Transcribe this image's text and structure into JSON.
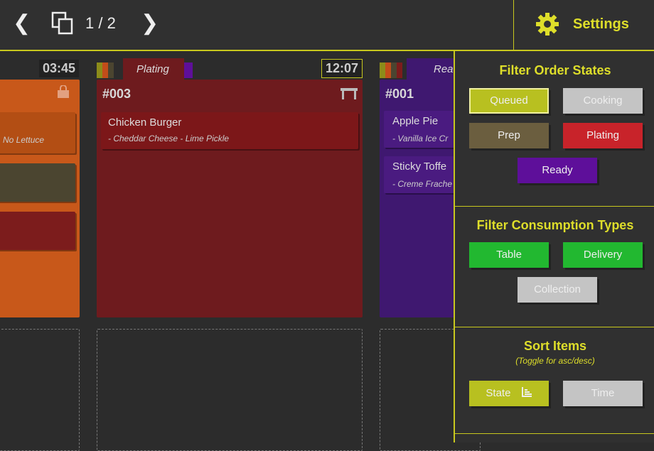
{
  "topbar": {
    "prev_icon": "chevron-left-icon",
    "next_icon": "chevron-right-icon",
    "pages_icon": "pages-icon",
    "page_label": "1 / 2",
    "settings_icon": "gear-icon",
    "settings_label": "Settings"
  },
  "orders": [
    {
      "number": "",
      "timer": "03:45",
      "state": "",
      "consumption_icon": "bag-icon",
      "color": "#c8581a",
      "items": [
        {
          "name": "",
          "mods": "No Lettuce",
          "color": "#b34e14"
        },
        {
          "name": "",
          "mods": "",
          "color": "#4b4530"
        },
        {
          "name": "",
          "mods": "",
          "color": "#7c1c1c"
        }
      ]
    },
    {
      "number": "#003",
      "timer": "12:07",
      "state": "Plating",
      "consumption_icon": "table-icon",
      "color": "#6e1b1e",
      "items": [
        {
          "name": "Chicken Burger",
          "mods": "- Cheddar Cheese - Lime Pickle",
          "color": "#7c1719"
        }
      ]
    },
    {
      "number": "#001",
      "timer": "",
      "state": "Read",
      "consumption_icon": "",
      "color": "#3f1870",
      "items": [
        {
          "name": "Apple Pie",
          "mods": "- Vanilla Ice Cr",
          "color": "#4a1b80"
        },
        {
          "name": "Sticky Toffe",
          "mods": "- Creme Frache",
          "color": "#4a1b80"
        }
      ]
    }
  ],
  "settings": {
    "order_states": {
      "title": "Filter Order States",
      "buttons": [
        {
          "label": "Queued",
          "color": "#b8c020",
          "active": true
        },
        {
          "label": "Cooking",
          "color": "#c4c4c4",
          "active": false
        },
        {
          "label": "Prep",
          "color": "#6b5e3f",
          "active": false
        },
        {
          "label": "Plating",
          "color": "#c8232a",
          "active": false
        },
        {
          "label": "Ready",
          "color": "#5e0f9a",
          "active": false
        }
      ]
    },
    "consumption": {
      "title": "Filter Consumption Types",
      "buttons": [
        {
          "label": "Table",
          "color": "#22b830"
        },
        {
          "label": "Delivery",
          "color": "#22b830"
        },
        {
          "label": "Collection",
          "color": "#c4c4c4"
        }
      ]
    },
    "sort": {
      "title": "Sort Items",
      "subtitle": "(Toggle for asc/desc)",
      "buttons": [
        {
          "label": "State",
          "icon": "sort-bars-icon",
          "color": "#b8c020"
        },
        {
          "label": "Time",
          "color": "#c4c4c4"
        }
      ]
    }
  },
  "colors": {
    "accent": "#c8c81e",
    "background": "#2c2c2c"
  }
}
